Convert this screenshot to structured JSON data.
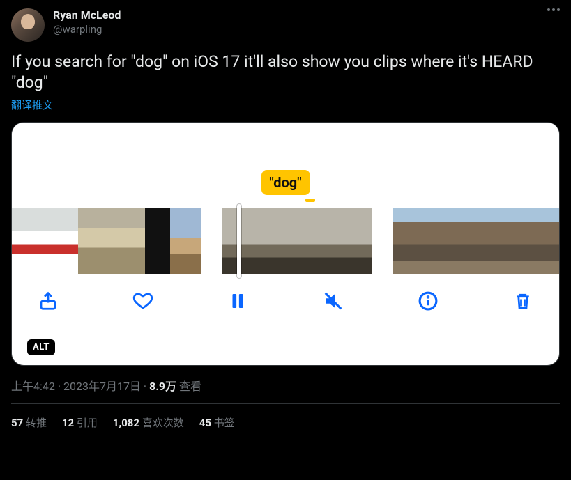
{
  "user": {
    "display_name": "Ryan McLeod",
    "handle": "@warpling"
  },
  "tweet": {
    "text": "If you search for \"dog\" on iOS 17 it'll also show you clips where it's HEARD \"dog\"",
    "translate_label": "翻译推文"
  },
  "media": {
    "search_pill": "\"dog\"",
    "alt_badge": "ALT"
  },
  "meta": {
    "time": "上午4:42",
    "sep1": " · ",
    "date": "2023年7月17日",
    "sep2": " · ",
    "views_num": "8.9万",
    "views_label": " 查看"
  },
  "stats": {
    "retweets_num": "57",
    "retweets_label": " 转推",
    "quotes_num": "12",
    "quotes_label": " 引用",
    "likes_num": "1,082",
    "likes_label": " 喜欢次数",
    "bookmarks_num": "45",
    "bookmarks_label": " 书签"
  }
}
